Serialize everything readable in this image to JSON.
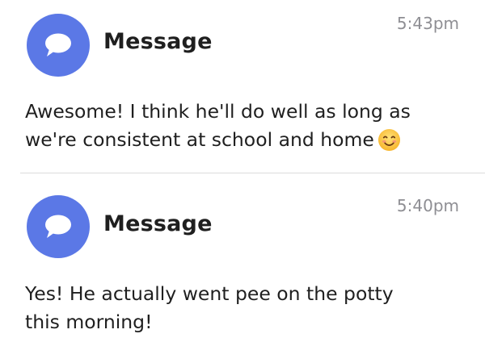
{
  "messages": [
    {
      "title": "Message",
      "time": "5:43pm",
      "lines": [
        "Awesome! I think he'll do well as long as",
        "we're consistent at school and home"
      ],
      "emoji": "smiling-face-emoji"
    },
    {
      "title": "Message",
      "time": "5:40pm",
      "lines": [
        "Yes! He actually went pee on the potty",
        "this morning!"
      ]
    }
  ],
  "colors": {
    "avatar": "#5b78e6",
    "timestamp": "#8e8e93",
    "text": "#1f1f1f",
    "divider": "#dcdcdc"
  }
}
